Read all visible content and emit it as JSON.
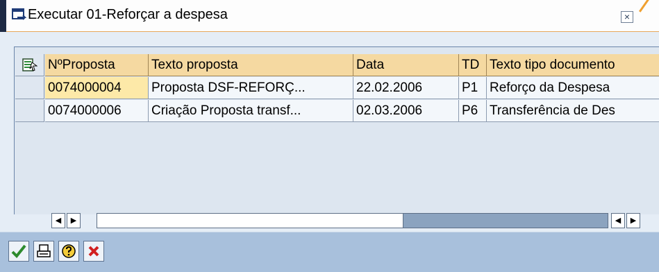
{
  "window": {
    "title": "Executar 01-Reforçar a despesa",
    "close_glyph": "×"
  },
  "table": {
    "columns": [
      "NºProposta",
      "Texto proposta",
      "Data",
      "TD",
      "Texto tipo documento"
    ],
    "rows": [
      {
        "num": "0074000004",
        "texto": "Proposta DSF-REFORÇ...",
        "data": "22.02.2006",
        "td": "P1",
        "tipo": "Reforço da Despesa"
      },
      {
        "num": "0074000006",
        "texto": "Criação Proposta  transf...",
        "data": "02.03.2006",
        "td": "P6",
        "tipo": "Transferência de Des"
      }
    ]
  },
  "scrollbar": {
    "left_arrow": "◀",
    "right_arrow": "▶",
    "position_fraction": 0.6
  },
  "toolbar": {
    "buttons": [
      "confirm",
      "print",
      "help",
      "cancel"
    ]
  },
  "colors": {
    "header_bg": "#f5d9a1",
    "highlight_cell": "#fde9a8",
    "toolbar_bg": "#a8c0dc",
    "window_bg": "#e5edf6"
  },
  "icons": [
    "window-icon",
    "close-icon",
    "table-config-icon",
    "checkmark-icon",
    "print-icon",
    "help-icon",
    "cancel-icon"
  ]
}
